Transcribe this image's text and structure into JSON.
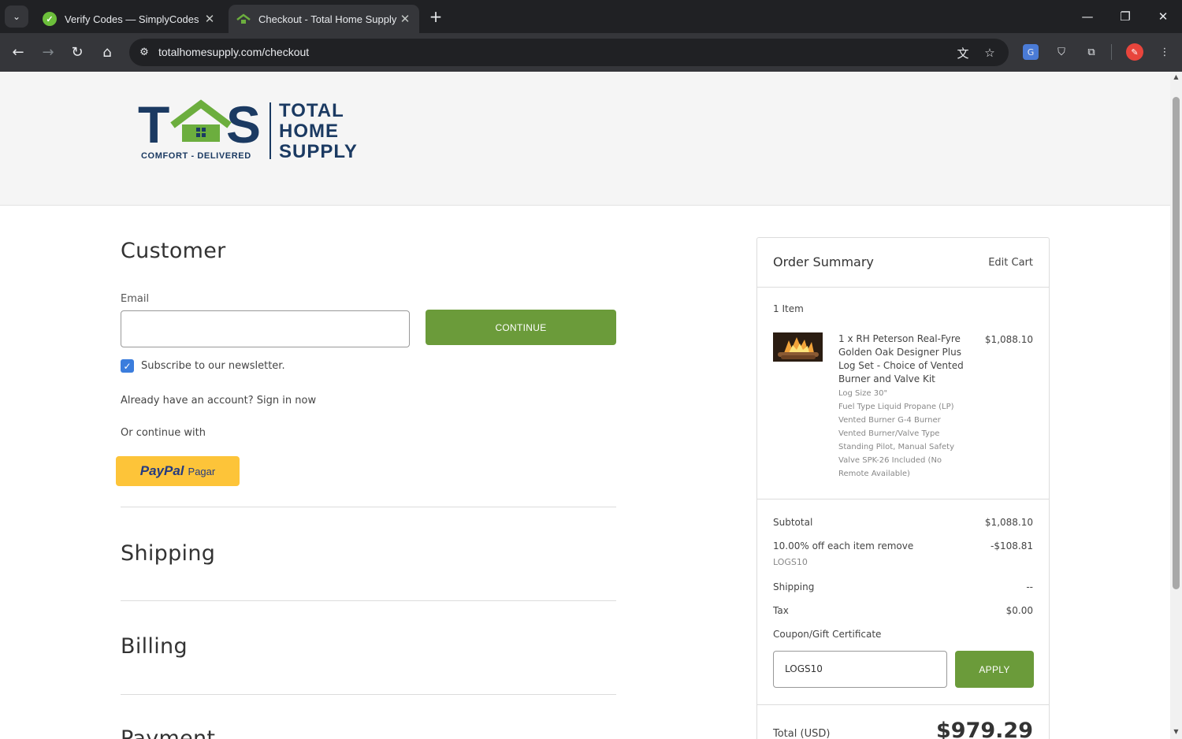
{
  "browser": {
    "tabs": [
      {
        "title": "Verify Codes — SimplyCodes",
        "active": false
      },
      {
        "title": "Checkout - Total Home Supply",
        "active": true
      }
    ],
    "url": "totalhomesupply.com/checkout"
  },
  "logo": {
    "letters": "THS",
    "tagline": "COMFORT - DELIVERED",
    "words": [
      "TOTAL",
      "HOME",
      "SUPPLY"
    ],
    "colors": {
      "navy": "#1b3a62",
      "green": "#6cae3e"
    }
  },
  "customer": {
    "heading": "Customer",
    "email_label": "Email",
    "email_value": "",
    "continue_label": "CONTINUE",
    "newsletter_label": "Subscribe to our newsletter.",
    "newsletter_checked": true,
    "account_prompt": "Already have an account? Sign in now",
    "or_continue": "Or continue with",
    "paypal_logo": "PayPal",
    "paypal_label": "Pagar"
  },
  "sections": {
    "shipping": "Shipping",
    "billing": "Billing",
    "payment": "Payment"
  },
  "summary": {
    "title": "Order Summary",
    "edit_cart": "Edit Cart",
    "item_count": "1 Item",
    "item": {
      "name_lines": [
        "1 x RH Peterson Real-Fyre",
        "Golden Oak Designer Plus",
        "Log Set - Choice of Vented",
        "Burner and Valve Kit"
      ],
      "price": "$1,088.10",
      "options": [
        "Log Size 30\"",
        "Fuel Type Liquid Propane (LP)",
        "Vented Burner G-4 Burner",
        "Vented Burner/Valve Type",
        "Standing Pilot, Manual Safety",
        "Valve SPK-26 Included (No",
        "Remote Available)"
      ]
    },
    "subtotal_label": "Subtotal",
    "subtotal_value": "$1,088.10",
    "discount_label": "10.00% off each item remove",
    "discount_value": "-$108.81",
    "discount_code": "LOGS10",
    "shipping_label": "Shipping",
    "shipping_value": "--",
    "tax_label": "Tax",
    "tax_value": "$0.00",
    "coupon_label": "Coupon/Gift Certificate",
    "coupon_value": "LOGS10",
    "apply_label": "APPLY",
    "total_label": "Total (USD)",
    "total_value": "$979.29"
  },
  "colors": {
    "accent_green": "#6b9b3a",
    "checkbox_blue": "#3b7ddd",
    "paypal_yellow": "#fdc439"
  }
}
